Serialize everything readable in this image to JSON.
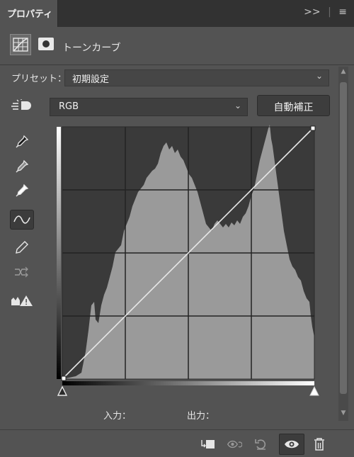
{
  "panel": {
    "tab_title": "プロパティ",
    "tab_tools": [
      ">>",
      "≡"
    ]
  },
  "header": {
    "title": "トーンカーブ"
  },
  "preset": {
    "label": "プリセット：",
    "value": "初期設定"
  },
  "channel": {
    "value": "RGB"
  },
  "auto_button": {
    "label": "自動補正"
  },
  "readout": {
    "input_label": "入力：",
    "output_label": "出力："
  },
  "colors": {
    "panel_bg": "#535353",
    "graph_bg": "#3a3a3a",
    "histogram": "#9a9a9a",
    "curve": "#e8e8e8"
  },
  "tools": [
    "target-adjust-icon",
    "black-eyedropper-icon",
    "gray-eyedropper-icon",
    "white-eyedropper-icon",
    "curve-point-icon",
    "pencil-icon",
    "smooth-icon",
    "clipping-warning-icon"
  ],
  "bottom_icons": [
    "clip-to-layer-icon",
    "view-previous-icon",
    "reset-icon",
    "visibility-eye-icon",
    "trash-icon"
  ]
}
